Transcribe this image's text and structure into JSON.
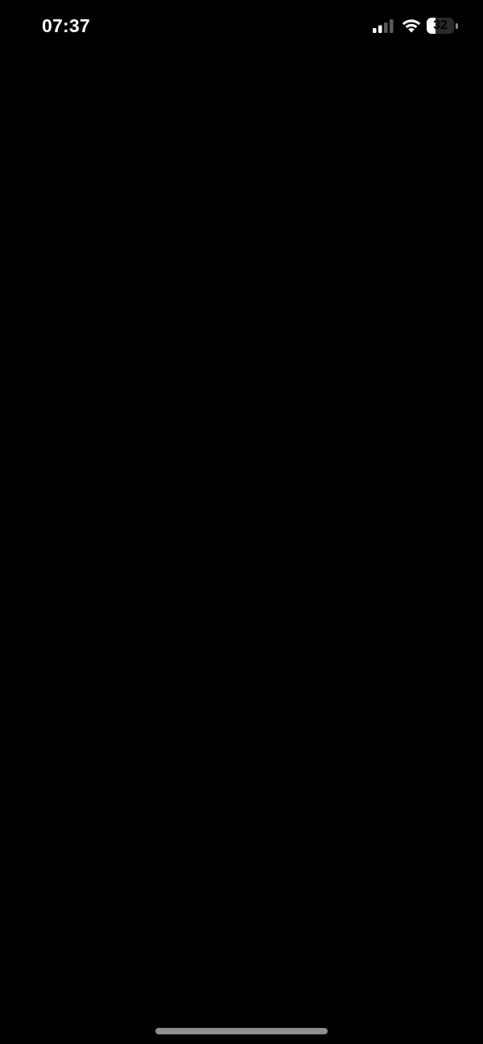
{
  "status_bar": {
    "time": "07:37",
    "battery_level": 32,
    "battery_label": "32",
    "signal_icon": "cellular-signal-icon",
    "wifi_icon": "wifi-icon",
    "battery_icon": "battery-icon"
  },
  "colors": {
    "background": "#000000",
    "foreground": "#ffffff",
    "home_indicator": "#8e8e8e"
  }
}
